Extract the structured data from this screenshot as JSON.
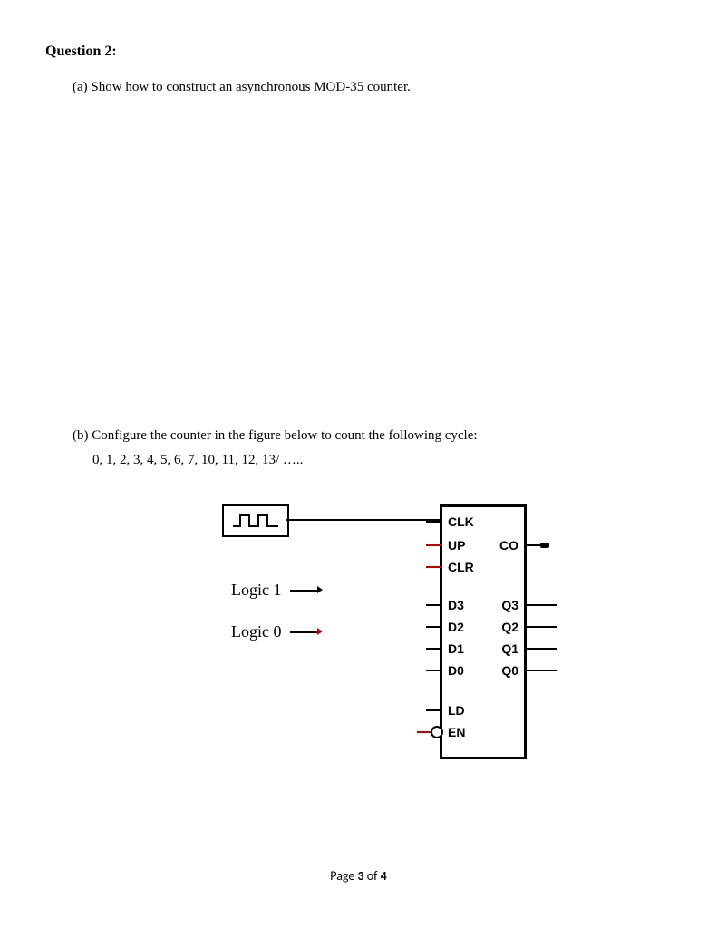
{
  "question": {
    "title": "Question 2:",
    "parts": {
      "a": {
        "marker": "(a)",
        "text": "Show how to construct an asynchronous MOD-35 counter."
      },
      "b": {
        "marker": "(b)",
        "text": "Configure the counter in the figure below to count the following cycle:",
        "sequence": "0, 1, 2, 3, 4, 5, 6, 7,    10,  11, 12, 13/ ….."
      }
    }
  },
  "diagram": {
    "logic1_label": "Logic 1",
    "logic0_label": "Logic 0",
    "chip": {
      "left_pins": {
        "clk": "CLK",
        "up": "UP",
        "clr": "CLR",
        "d3": "D3",
        "d2": "D2",
        "d1": "D1",
        "d0": "D0",
        "ld": "LD",
        "en": "EN"
      },
      "right_pins": {
        "co": "CO",
        "q3": "Q3",
        "q2": "Q2",
        "q1": "Q1",
        "q0": "Q0"
      }
    }
  },
  "footer": {
    "prefix": "Page ",
    "current": "3",
    "of": " of ",
    "total": "4"
  }
}
